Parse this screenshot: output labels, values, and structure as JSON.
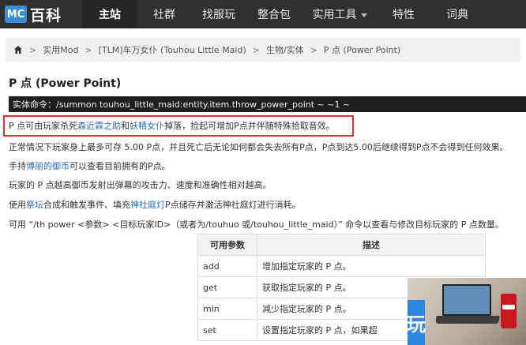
{
  "nav": {
    "logo_badge": "MC",
    "logo_text": "百科",
    "items": [
      {
        "label": "主站",
        "active": true
      },
      {
        "label": "社群",
        "active": false
      },
      {
        "label": "找服玩",
        "active": false
      },
      {
        "label": "整合包",
        "active": false
      },
      {
        "label": "实用工具",
        "active": false,
        "dropdown": true
      },
      {
        "label": "特性",
        "active": false
      },
      {
        "label": "词典",
        "active": false
      }
    ]
  },
  "breadcrumb": {
    "home_icon": "home-icon",
    "items": [
      "实用Mod",
      "[TLM]车万女仆 (Touhou Little Maid)",
      "生物/实体",
      "P 点 (Power Point)"
    ]
  },
  "page": {
    "title": "P 点 (Power Point)",
    "command": "实体命令：/summon touhou_little_maid:entity.item.throw_power_point ~ ~1 ~",
    "p1": {
      "pre": "P 点可由玩家杀死",
      "link1": "森近霖之助",
      "mid": "和",
      "link2": "妖精女仆",
      "post": "掉落，捡起可增加P点并伴随特殊拾取音效。"
    },
    "p2": "正常情况下玩家身上最多可存 5.00 P点，并且死亡后无论如何都会失去所有P点，P点到达5.00后继续得到P点不会得到任何效果。",
    "p3": {
      "pre": "手持",
      "link": "博丽的御币",
      "post": "可以查看目前拥有的P点。"
    },
    "p4": "玩家的 P 点越高御币发射出弹幕的攻击力、速度和准确性相对越高。",
    "p5": {
      "pre": "使用",
      "link1": "祭坛",
      "mid": "合成和触发事件、填充",
      "link2": "神社庭灯",
      "post": "P点储存并激活神社庭灯进行消耗。"
    },
    "p6": "可用 “/th power <参数> <目标玩家ID>（或者为/touhuo 或/touhou_little_maid）” 命令以查看与修改目标玩家的 P 点数量。"
  },
  "table": {
    "headers": [
      "可用参数",
      "描述"
    ],
    "rows": [
      [
        "add",
        "增加指定玩家的 P 点。"
      ],
      [
        "get",
        "获取指定玩家的 P 点。"
      ],
      [
        "min",
        "减少指定玩家的 P 点。"
      ],
      [
        "set",
        "设置指定玩家的 P 点，如果超"
      ]
    ]
  },
  "ad": {
    "tag_text": "玩",
    "colors": {
      "tag": "#2b87e0",
      "can": "#c8171f"
    }
  },
  "colors": {
    "nav_bg": "#2f2f2f",
    "link": "#2a6fb8",
    "highlight_border": "#e0302f",
    "logo_badge": "#3a8fd9"
  }
}
